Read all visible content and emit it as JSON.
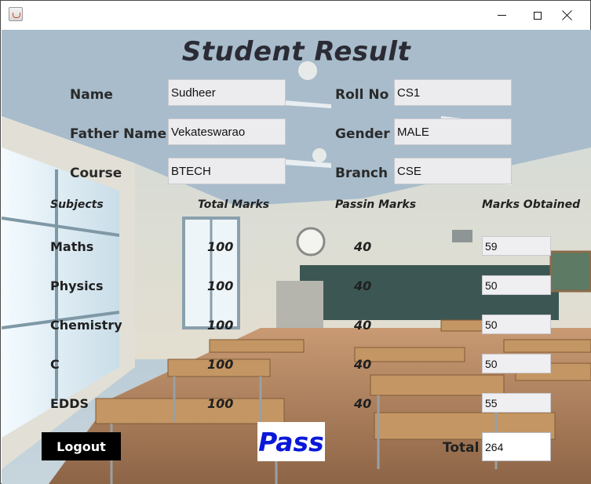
{
  "window": {
    "controls": {
      "minimize_icon": "minimize-icon",
      "maximize_icon": "maximize-icon",
      "close_icon": "close-icon"
    }
  },
  "form": {
    "title": "Student Result",
    "labels": {
      "name": "Name",
      "roll_no": "Roll No",
      "father_name": "Father Name",
      "gender": "Gender",
      "course": "Course",
      "branch": "Branch"
    },
    "values": {
      "name": "Sudheer",
      "roll_no": "CS1",
      "father_name": "Vekateswarao",
      "gender": "MALE",
      "course": "BTECH",
      "branch": "CSE"
    }
  },
  "table": {
    "headers": {
      "subjects": "Subjects",
      "total_marks": "Total Marks",
      "passing_marks": "Passin Marks",
      "marks_obtained": "Marks Obtained"
    },
    "rows": [
      {
        "subject": "Maths",
        "total": "100",
        "passing": "40",
        "obtained": "59"
      },
      {
        "subject": "Physics",
        "total": "100",
        "passing": "40",
        "obtained": "50"
      },
      {
        "subject": "Chemistry",
        "total": "100",
        "passing": "40",
        "obtained": "50"
      },
      {
        "subject": "C",
        "total": "100",
        "passing": "40",
        "obtained": "50"
      },
      {
        "subject": "EDDS",
        "total": "100",
        "passing": "40",
        "obtained": "55"
      }
    ]
  },
  "footer": {
    "logout_label": "Logout",
    "result": "Pass",
    "total_label": "Total",
    "total_value": "264"
  },
  "colors": {
    "result_text": "#0a18d8",
    "logout_bg": "#000000"
  }
}
